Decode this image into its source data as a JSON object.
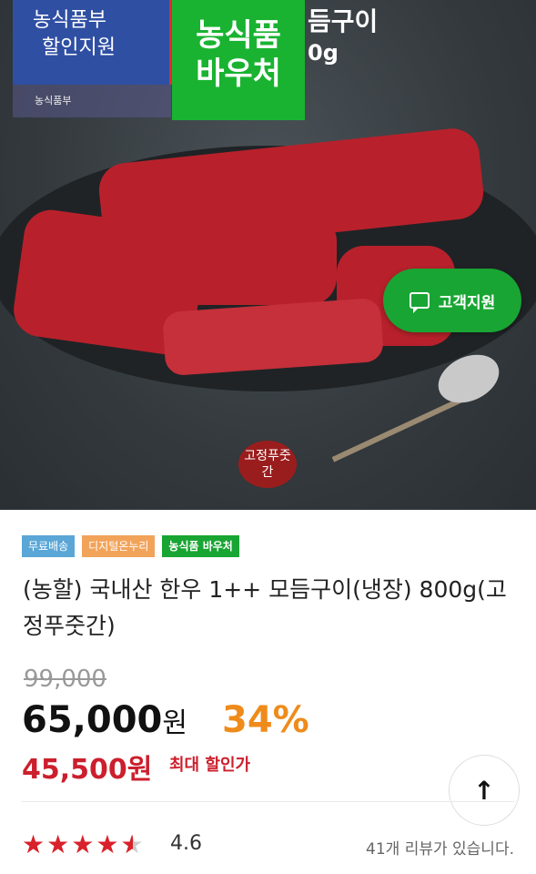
{
  "hero": {
    "badge_blue_line1": "농식품부",
    "badge_blue_line2": "할인지원",
    "badge_green_line1": "농식품",
    "badge_green_line2": "바우처",
    "head_text": "듬구이",
    "head_sub": "0g",
    "seal_text": "농식품부",
    "stamp_text": "고정푸줏간"
  },
  "support_button": {
    "label": "고객지원"
  },
  "tags": [
    {
      "label": "무료배송",
      "color": "#5aa6d6"
    },
    {
      "label": "디지털온누리",
      "color": "#f2a35a"
    },
    {
      "label": "농식품 바우처",
      "color": "#19a533"
    }
  ],
  "product": {
    "title": "(농할) 국내산 한우 1++ 모듬구이(냉장) 800g(고정푸줏간)",
    "original_price": "99,000",
    "price_number": "65,000",
    "price_unit": "원",
    "discount_rate": "34%",
    "min_price": "45,500원",
    "min_price_label": "최대 할인가",
    "rating": "4.6",
    "review_text": "41개 리뷰가 있습니다."
  },
  "scroll_top": {
    "icon": "arrow-up-icon"
  }
}
